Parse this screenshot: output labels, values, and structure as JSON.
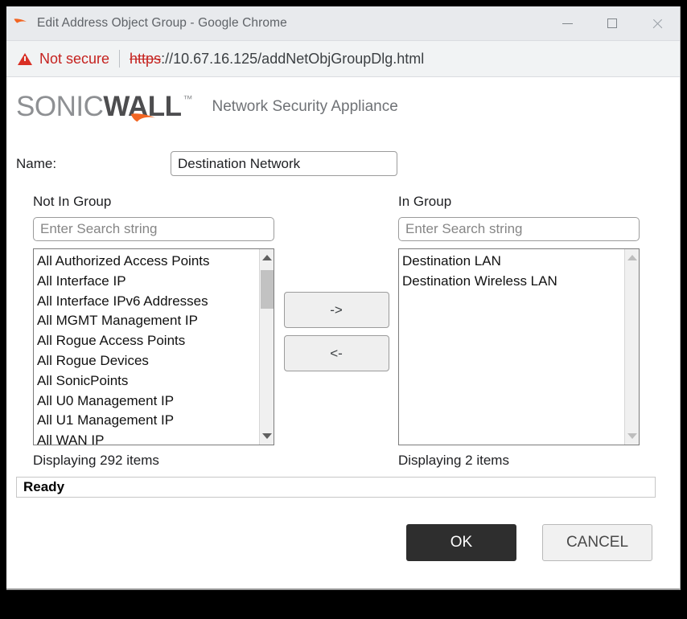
{
  "window": {
    "title": "Edit Address Object Group - Google Chrome",
    "favicon": "sonicwall-swoosh-icon",
    "controls": {
      "minimize": "minimize-icon",
      "maximize": "maximize-icon",
      "close": "close-icon"
    }
  },
  "urlbar": {
    "warning_icon": "warning-triangle-icon",
    "security_label": "Not secure",
    "url_scheme": "https",
    "url_rest": "://10.67.16.125/addNetObjGroupDlg.html"
  },
  "brand": {
    "logo_part1": "SONIC",
    "logo_part2": "WALL",
    "trademark": "™",
    "subtitle": "Network Security Appliance",
    "accent_color": "#f26522",
    "logo_gray": "#8e9093",
    "logo_dark": "#4d4d4f"
  },
  "form": {
    "name_label": "Name:",
    "name_value": "Destination Network",
    "name_placeholder": ""
  },
  "panels": {
    "left": {
      "title": "Not In Group",
      "search_value": "",
      "search_placeholder": "Enter Search string",
      "items": [
        "All Authorized Access Points",
        "All Interface IP",
        "All Interface IPv6 Addresses",
        "All MGMT Management IP",
        "All Rogue Access Points",
        "All Rogue Devices",
        "All SonicPoints",
        "All U0 Management IP",
        "All U1 Management IP",
        "All WAN IP"
      ],
      "count_label": "Displaying 292 items",
      "scroll_up_icon": "scroll-up-arrow-icon",
      "scroll_down_icon": "scroll-down-arrow-icon"
    },
    "right": {
      "title": "In Group",
      "search_value": "",
      "search_placeholder": "Enter Search string",
      "items": [
        "Destination LAN",
        "Destination Wireless LAN"
      ],
      "count_label": "Displaying 2 items",
      "scroll_up_icon": "scroll-up-arrow-icon",
      "scroll_down_icon": "scroll-down-arrow-icon"
    }
  },
  "transfer": {
    "add_label": "->",
    "remove_label": "<-"
  },
  "status": {
    "text": "Ready"
  },
  "footer": {
    "ok_label": "OK",
    "cancel_label": "CANCEL",
    "ok_bg": "#2e2e2e",
    "cancel_bg": "#f1f1f1"
  }
}
